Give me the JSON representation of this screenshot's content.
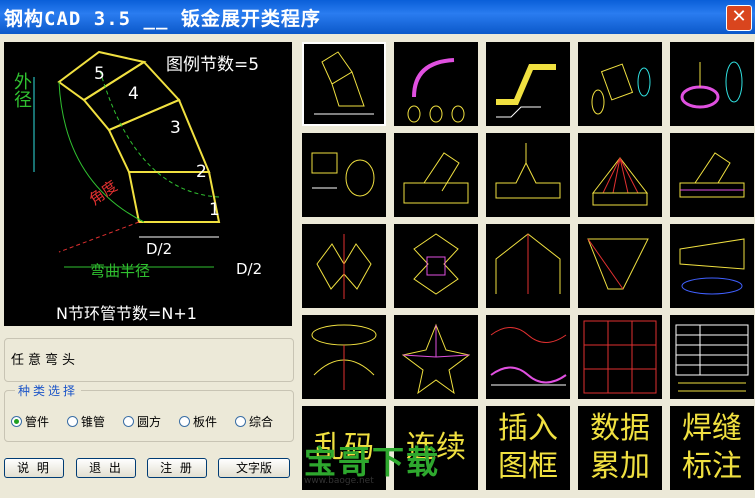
{
  "window": {
    "title": "钢构CAD 3.5 __ 钣金展开类程序",
    "close": "✕"
  },
  "preview": {
    "outer_dia": "外径",
    "D_label": "D",
    "segments_label": "图例节数=5",
    "seg_numbers": [
      "5",
      "4",
      "3",
      "2",
      "1"
    ],
    "angle_label": "角度",
    "d2_a": "D/2",
    "d2_b": "D/2",
    "bend_radius": "弯曲半径",
    "formula": "N节环管节数=N+1"
  },
  "elbow": "任意弯头",
  "category": {
    "legend": "种类选择",
    "options": [
      "管件",
      "锥管",
      "圆方",
      "板件",
      "综合"
    ],
    "selected": 0
  },
  "buttons": {
    "about": "说 明",
    "exit": "退 出",
    "register": "注 册",
    "text_ver": "文字版"
  },
  "thumbnails": [
    [
      "elbow",
      "elbow-7seg",
      "z-pipe",
      "rect-round",
      "tee-dome"
    ],
    [
      "cyl-cut",
      "branch",
      "y-tee",
      "cone-fan",
      "saddle"
    ],
    [
      "pipe-y",
      "cross",
      "house",
      "trapezoid",
      "cone-long"
    ],
    [
      "ring",
      "star",
      "wave",
      "grid",
      "table"
    ]
  ],
  "text_cells": [
    "乱码",
    "连续",
    "插入图框",
    "数据累加",
    "焊缝标注"
  ],
  "watermark": {
    "main": "宝哥下载",
    "url": "www.baoge.net"
  }
}
